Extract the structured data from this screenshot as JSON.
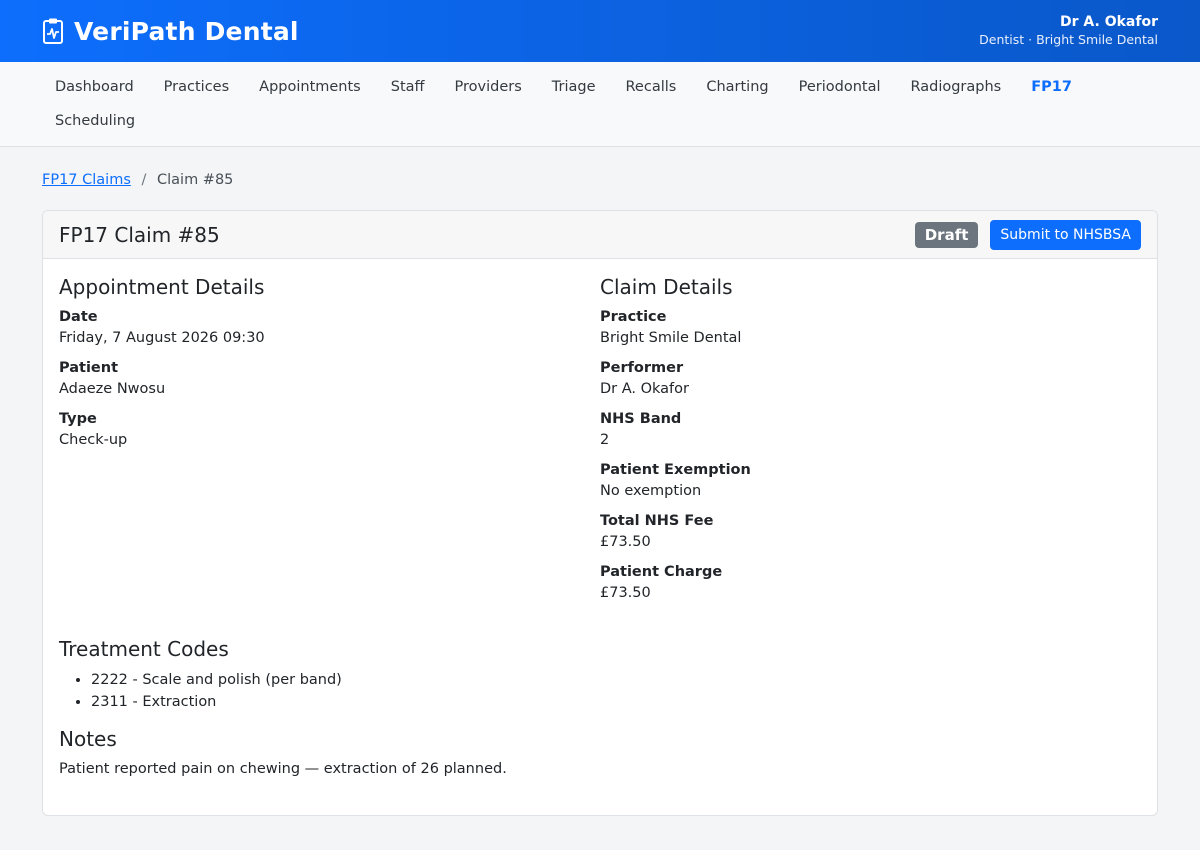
{
  "app": {
    "name": "VeriPath Dental",
    "user_name": "Dr A. Okafor",
    "user_role": "Dentist · Bright Smile Dental"
  },
  "nav": {
    "items": [
      {
        "label": "Dashboard"
      },
      {
        "label": "Practices"
      },
      {
        "label": "Appointments"
      },
      {
        "label": "Staff"
      },
      {
        "label": "Providers"
      },
      {
        "label": "Triage"
      },
      {
        "label": "Recalls"
      },
      {
        "label": "Charting"
      },
      {
        "label": "Periodontal"
      },
      {
        "label": "Radiographs"
      },
      {
        "label": "FP17"
      },
      {
        "label": "Scheduling"
      }
    ],
    "active": "FP17"
  },
  "breadcrumb": {
    "parent": "FP17 Claims",
    "separator": "/",
    "current": "Claim #85"
  },
  "claim": {
    "title": "FP17 Claim #85",
    "status": "Draft",
    "submit_label": "Submit to NHSBSA"
  },
  "appointment": {
    "heading": "Appointment Details",
    "fields": [
      {
        "label": "Date",
        "value": "Friday, 7 August 2026 09:30"
      },
      {
        "label": "Patient",
        "value": "Adaeze Nwosu"
      },
      {
        "label": "Type",
        "value": "Check-up"
      }
    ]
  },
  "claim_details": {
    "heading": "Claim Details",
    "fields": [
      {
        "label": "Practice",
        "value": "Bright Smile Dental"
      },
      {
        "label": "Performer",
        "value": "Dr A. Okafor"
      },
      {
        "label": "NHS Band",
        "value": "2"
      },
      {
        "label": "Patient Exemption",
        "value": "No exemption"
      },
      {
        "label": "Total NHS Fee",
        "value": "£73.50"
      },
      {
        "label": "Patient Charge",
        "value": "£73.50"
      }
    ]
  },
  "treatment": {
    "heading": "Treatment Codes",
    "codes": [
      "2222 - Scale and polish (per band)",
      "2311 - Extraction"
    ]
  },
  "notes": {
    "heading": "Notes",
    "text": "Patient reported pain on chewing — extraction of 26 planned."
  },
  "colors": {
    "primary": "#0d6efd",
    "badge_draft": "#6c757d",
    "background": "#f4f5f7"
  }
}
